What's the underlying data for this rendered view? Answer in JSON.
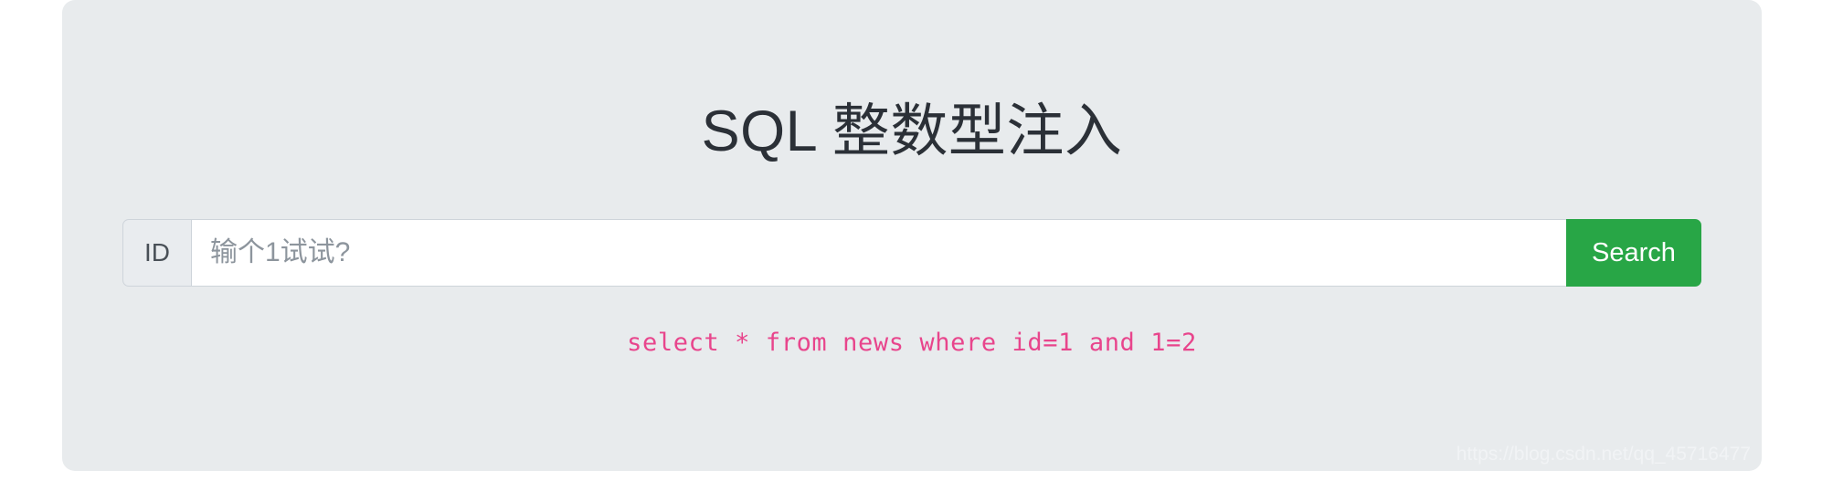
{
  "page": {
    "background_color": "#ffffff",
    "panel_color": "#e8ebed"
  },
  "header": {
    "title": "SQL 整数型注入",
    "title_color": "#2b3037"
  },
  "search_form": {
    "prefix_label": "ID",
    "input_value": "",
    "input_placeholder": "输个1试试?",
    "submit_label": "Search",
    "submit_color": "#28a646",
    "placeholder_color": "#8d959d"
  },
  "result": {
    "sql_query": "select * from news where id=1 and 1=2",
    "sql_color": "#e8458c"
  },
  "watermark": {
    "text": "https://blog.csdn.net/qq_45716477"
  }
}
